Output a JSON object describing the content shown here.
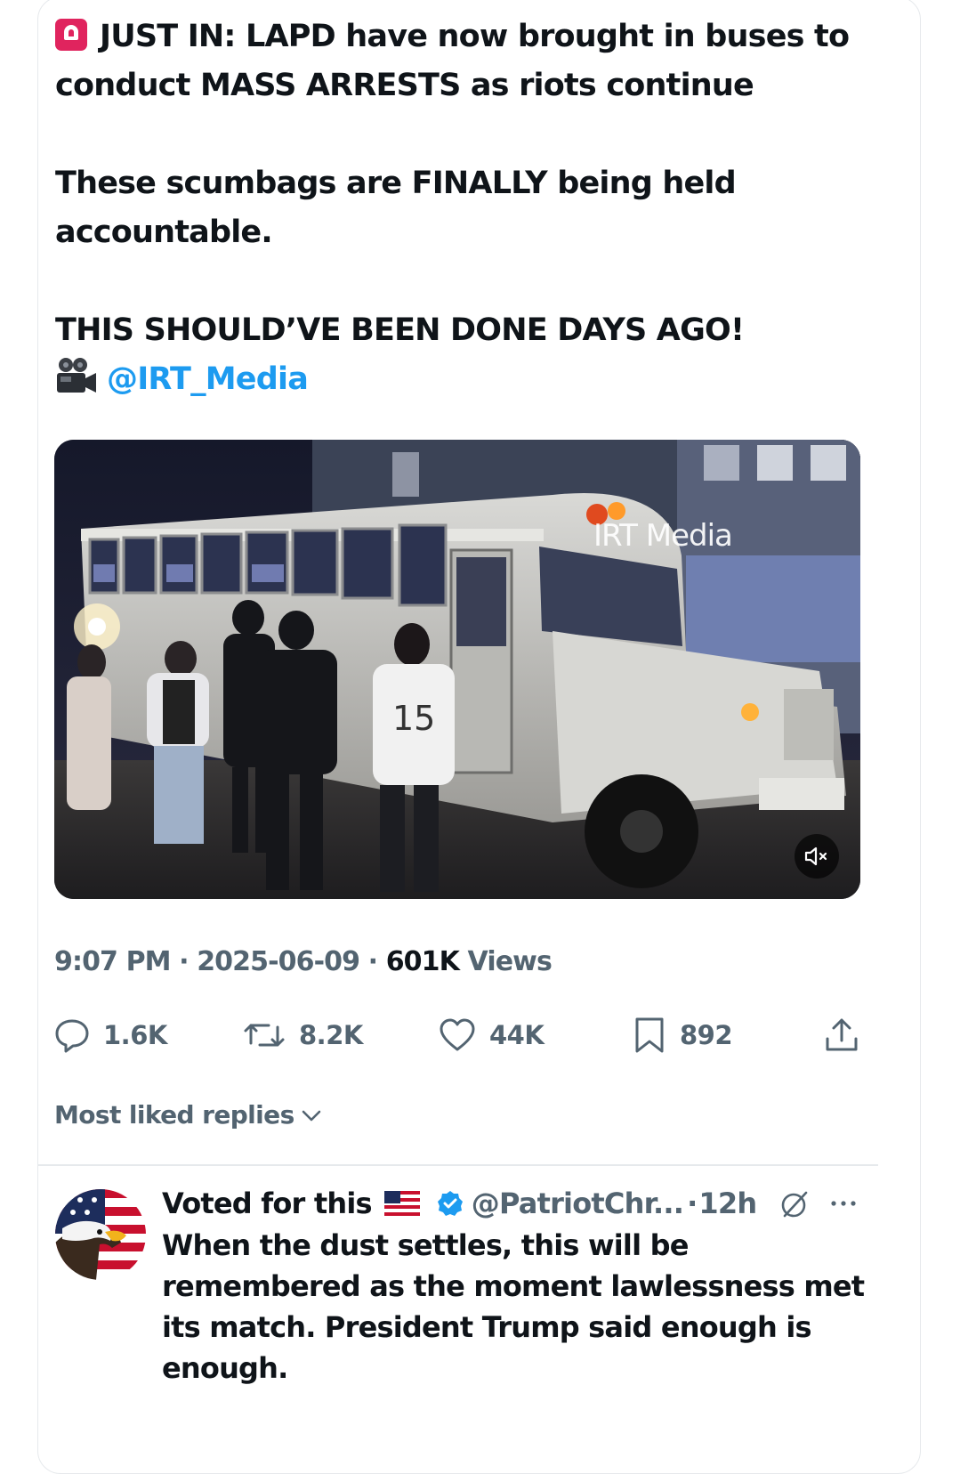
{
  "tweet": {
    "line1": "JUST IN: LAPD have now brought in buses to conduct MASS ARRESTS as riots continue",
    "line2": "These scumbags are FINALLY being held accountable.",
    "line3": "THIS SHOULD’VE BEEN DONE DAYS AGO!",
    "mention": "@IRT_Media",
    "media_watermark": "IRT Media",
    "time": "9:07 PM",
    "date": "2025-06-09",
    "views_count": "601K",
    "views_label": "Views",
    "sep": " · "
  },
  "actions": {
    "replies": "1.6K",
    "reposts": "8.2K",
    "likes": "44K",
    "bookmarks": "892"
  },
  "replies_section": {
    "label": "Most liked replies"
  },
  "reply": {
    "display_name": "Voted for this",
    "handle": "@PatriotChr...",
    "time": "12h",
    "text": "When the dust settles, this will be remembered as the moment lawlessness met its match. President Trump said enough is enough."
  },
  "colors": {
    "text": "#0f1419",
    "secondary": "#536471",
    "link": "#1d9bf0",
    "border": "#e6e9ec"
  },
  "icons": [
    "siren-icon",
    "movie-camera-icon",
    "mute-icon",
    "reply-icon",
    "repost-icon",
    "like-icon",
    "bookmark-icon",
    "share-icon",
    "chevron-down-icon",
    "us-flag-icon",
    "verified-badge-icon",
    "grok-icon",
    "more-icon"
  ]
}
